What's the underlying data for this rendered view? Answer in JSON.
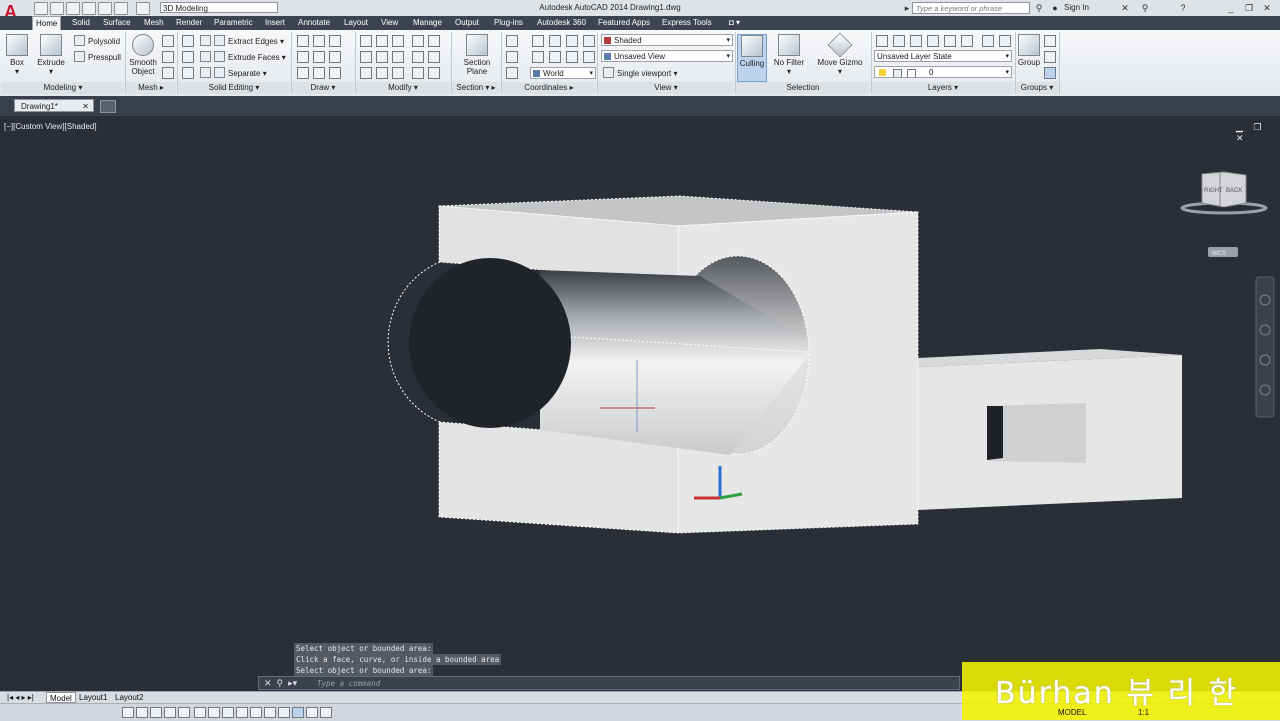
{
  "app": {
    "title": "Autodesk AutoCAD 2014    Drawing1.dwg",
    "workspace": "3D Modeling",
    "search_placeholder": "Type a keyword or phrase",
    "sign_in": "Sign In"
  },
  "ribbon": {
    "tabs": [
      "Home",
      "Solid",
      "Surface",
      "Mesh",
      "Render",
      "Parametric",
      "Insert",
      "Annotate",
      "Layout",
      "View",
      "Manage",
      "Output",
      "Plug-ins",
      "Autodesk 360",
      "Featured Apps",
      "Express Tools"
    ],
    "active_tab": "Home",
    "modeling": {
      "box": "Box",
      "extrude": "Extrude",
      "polysolid": "Polysolid",
      "presspull": "Presspull",
      "title": "Modeling"
    },
    "mesh": {
      "smooth_object_1": "Smooth",
      "smooth_object_2": "Object",
      "title": "Mesh"
    },
    "solid_editing": {
      "extract_edges": "Extract Edges",
      "extrude_faces": "Extrude Faces",
      "separate": "Separate",
      "title": "Solid Editing"
    },
    "draw": {
      "title": "Draw"
    },
    "modify": {
      "title": "Modify"
    },
    "section": {
      "section_plane_1": "Section",
      "section_plane_2": "Plane",
      "title": "Section"
    },
    "coordinates": {
      "world": "World",
      "title": "Coordinates"
    },
    "view": {
      "visual_style": "Shaded",
      "named_view": "Unsaved View",
      "viewport": "Single viewport",
      "title": "View"
    },
    "selection": {
      "culling": "Culling",
      "no_filter": "No Filter",
      "move_gizmo": "Move Gizmo",
      "title": "Selection"
    },
    "layers": {
      "layer_state": "Unsaved Layer State",
      "current_layer": "0",
      "title": "Layers"
    },
    "groups": {
      "group": "Group",
      "title": "Groups"
    }
  },
  "file_tab": "Drawing1*",
  "viewport": {
    "label": "[−][Custom View][Shaded]",
    "controls": "▁ ❐ ✕",
    "viewcube_right": "RIGHT",
    "viewcube_back": "BACK",
    "wcs": "WCS"
  },
  "command": {
    "history": [
      "Select object or bounded area:",
      "Click a face, curve, or inside a bounded area",
      "Select object or bounded area:"
    ],
    "placeholder": "Type a command"
  },
  "layouts": [
    "Model",
    "Layout1",
    "Layout2"
  ],
  "status": {
    "model": "MODEL",
    "scale": "1:1"
  },
  "watermark": "Bürhan 뷰 리 한",
  "colors": {
    "accent": "#3d4451",
    "viewport_bg": "#2a2e37",
    "watermark": "#f2f200"
  }
}
